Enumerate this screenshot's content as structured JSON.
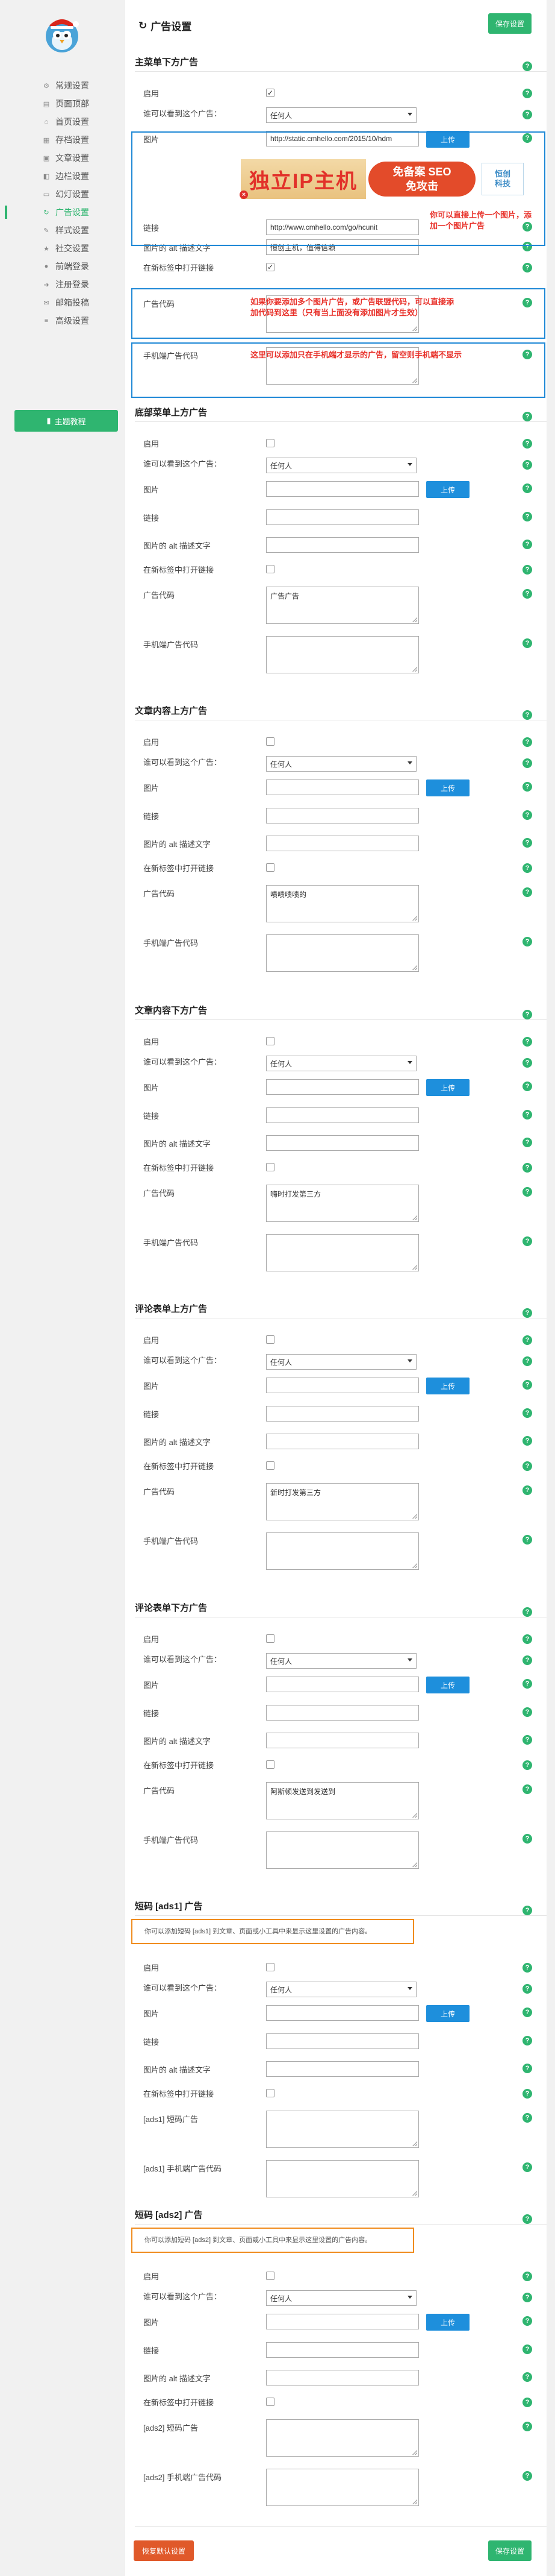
{
  "sidebar": {
    "items": [
      {
        "label": "常规设置",
        "icon": "gear-icon"
      },
      {
        "label": "页面顶部",
        "icon": "header-icon"
      },
      {
        "label": "首页设置",
        "icon": "home-icon"
      },
      {
        "label": "存档设置",
        "icon": "archive-icon"
      },
      {
        "label": "文章设置",
        "icon": "document-icon"
      },
      {
        "label": "边栏设置",
        "icon": "sidebar-icon"
      },
      {
        "label": "幻灯设置",
        "icon": "slides-icon"
      },
      {
        "label": "广告设置",
        "icon": "refresh-icon",
        "active": true
      },
      {
        "label": "样式设置",
        "icon": "brush-icon"
      },
      {
        "label": "社交设置",
        "icon": "star-icon"
      },
      {
        "label": "前端登录",
        "icon": "user-icon"
      },
      {
        "label": "注册登录",
        "icon": "login-icon"
      },
      {
        "label": "邮箱投稿",
        "icon": "mail-icon"
      },
      {
        "label": "高级设置",
        "icon": "sliders-icon"
      }
    ],
    "theme_button": "主题教程"
  },
  "header": {
    "title": "广告设置",
    "save": "保存设置"
  },
  "common": {
    "enable": "启用",
    "visible_who": "谁可以看到这个广告：",
    "who_value": "任何人",
    "image": "图片",
    "upload": "上传",
    "link": "链接",
    "alt": "图片的 alt 描述文字",
    "newtab": "在新标签中打开链接",
    "ad_code": "广告代码",
    "mobile_code": "手机端广告代码"
  },
  "sections": [
    {
      "title": "主菜单下方广告",
      "image_value": "http://static.cmhello.com/2015/10/hdm",
      "link_value": "http://www.cmhello.com/go/hcunit",
      "alt_value": "恒创主机，值得信赖",
      "ad_code_value": ""
    },
    {
      "title": "底部菜单上方广告",
      "ad_code_value": "广告广告"
    },
    {
      "title": "文章内容上方广告",
      "ad_code_value": "啧啧啧啧的"
    },
    {
      "title": "文章内容下方广告",
      "ad_code_value": "嗨时打发第三方"
    },
    {
      "title": "评论表单上方广告",
      "ad_code_value": "新时打发第三方"
    },
    {
      "title": "评论表单下方广告",
      "ad_code_value": "阿斯顿发送到发送到"
    },
    {
      "title": "短码 [ads1] 广告",
      "note": "你可以添加短码 [ads1] 到文章、页面或小工具中来显示这里设置的广告内容。",
      "ad_code_label": "[ads1] 短码广告",
      "mobile_label": "[ads1] 手机端广告代码"
    },
    {
      "title": "短码 [ads2] 广告",
      "note": "你可以添加短码 [ads2] 到文章、页面或小工具中来显示这里设置的广告内容。",
      "ad_code_label": "[ads2] 短码广告",
      "mobile_label": "[ads2] 手机端广告代码"
    }
  ],
  "banner": {
    "left": "独立IP主机",
    "mid1": "免备案 SEO",
    "mid2": "免攻击",
    "right1": "恒创",
    "right2": "科技"
  },
  "annotations": {
    "a1": "你可以直接上传一个图片，添加一个图片广告",
    "a2a": "如果你要添加多个图片广告，或广告联盟代码，可以直接添",
    "a2b": "加代码到这里（只有当上面没有添加图片才生效）",
    "a3": "这里可以添加只在手机端才显示的广告，留空则手机端不显示"
  },
  "footer": {
    "reset": "恢复默认设置",
    "save": "保存设置"
  },
  "colors": {
    "accent": "#2fb570",
    "upload": "#1e8fdc",
    "reset": "#e0592a",
    "highlight_blue": "#1e88d6",
    "highlight_orange": "#f08c1e",
    "annotation": "#e8312a"
  }
}
